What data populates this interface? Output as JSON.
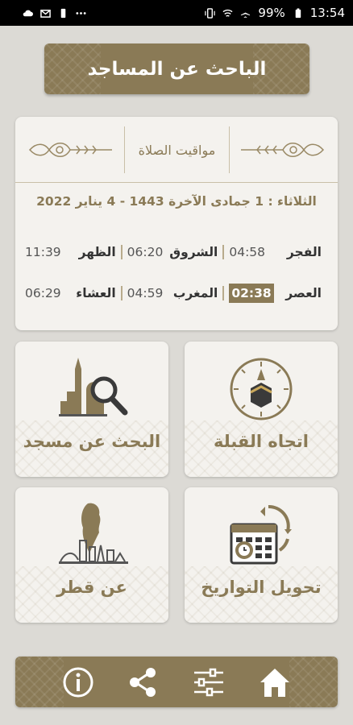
{
  "status_bar": {
    "battery": "99%",
    "time": "13:54",
    "left_icons": [
      "cloud-icon",
      "gmail-icon",
      "bag-icon",
      "more-dots-icon"
    ],
    "right_icons": [
      "vibrate-icon",
      "wifi-icon",
      "airplane-icon",
      "battery-icon"
    ]
  },
  "header": {
    "title": "الباحث عن المساجد"
  },
  "prayer_times": {
    "title": "مواقيت الصلاة",
    "date_line": "الثلاثاء : 1 جمادى الآخرة 1443 - 4 يناير 2022",
    "row1": [
      {
        "name": "الفجر",
        "time": "04:58"
      },
      {
        "name": "الشروق",
        "time": "06:20"
      },
      {
        "name": "الظهر",
        "time": "11:39"
      }
    ],
    "row2": [
      {
        "name": "العصر",
        "time": "02:38",
        "active": true
      },
      {
        "name": "المغرب",
        "time": "04:59"
      },
      {
        "name": "العشاء",
        "time": "06:29"
      }
    ]
  },
  "tiles": {
    "qibla": "اتجاه القبلة",
    "mosque_search": "البحث عن مسجد",
    "date_convert": "تحويل التواريخ",
    "about_qatar": "عن قطر"
  },
  "bottom_nav": {
    "icons": [
      "home-icon",
      "settings-sliders-icon",
      "share-icon",
      "info-icon"
    ]
  },
  "colors": {
    "accent": "#8a7a56",
    "background": "#dcdad5",
    "card": "#f4f2ee"
  }
}
